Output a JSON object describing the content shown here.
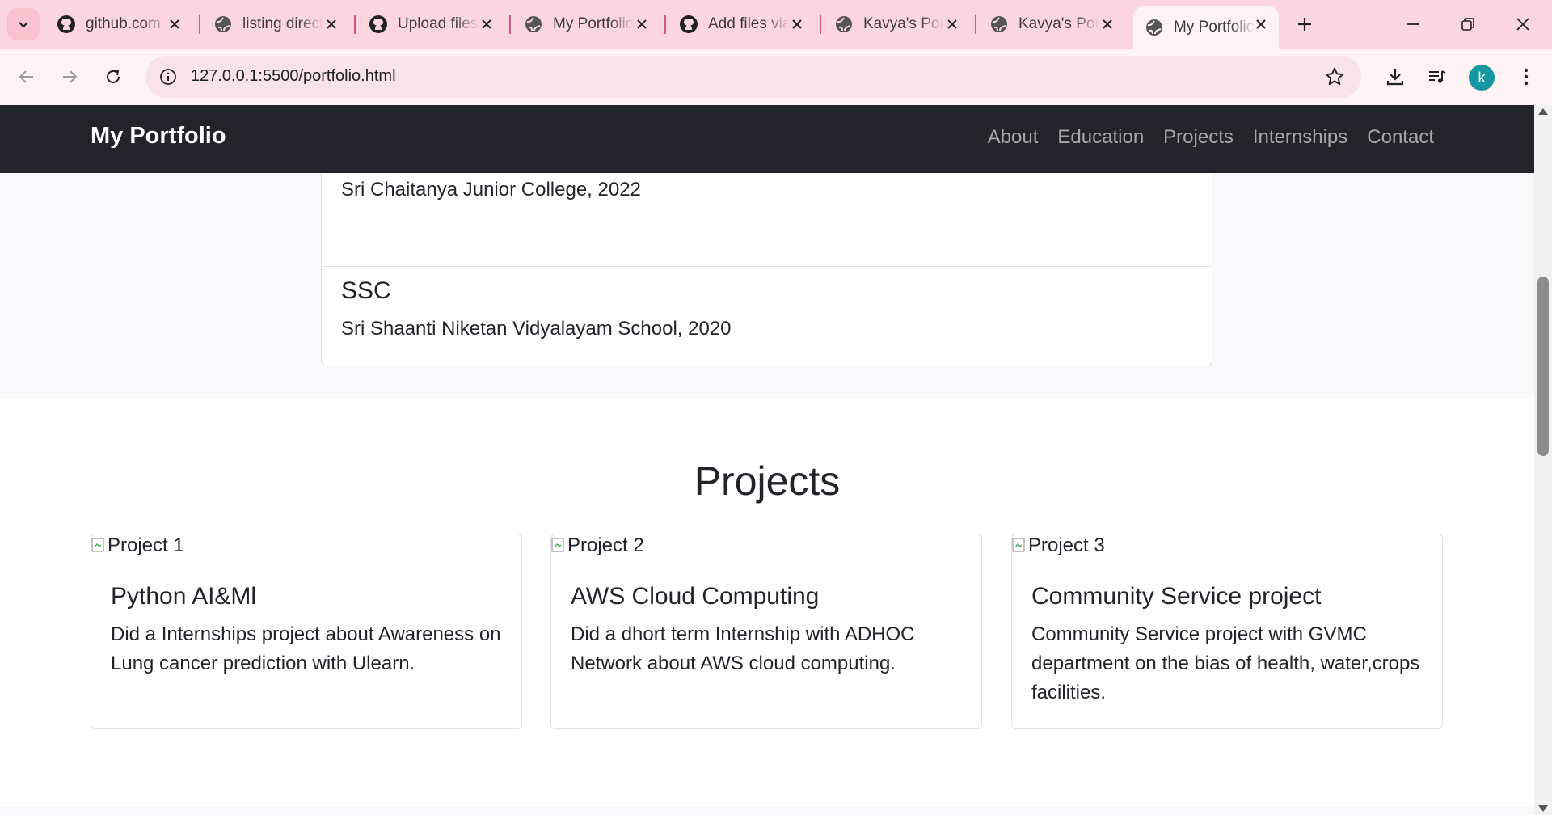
{
  "browser": {
    "tabs": [
      {
        "title": "github.com",
        "icon": "github-icon"
      },
      {
        "title": "listing directory",
        "icon": "globe-icon"
      },
      {
        "title": "Upload files",
        "icon": "github-icon"
      },
      {
        "title": "My Portfolio",
        "icon": "globe-icon"
      },
      {
        "title": "Add files via",
        "icon": "github-icon"
      },
      {
        "title": "Kavya's Portfolio",
        "icon": "globe-icon"
      },
      {
        "title": "Kavya's Portfolio",
        "icon": "globe-icon"
      },
      {
        "title": "My Portfolio",
        "icon": "globe-icon",
        "active": true
      }
    ],
    "url": "127.0.0.1:5500/portfolio.html",
    "profile_initial": "k",
    "colors": {
      "tabbar": "#fcd6de",
      "toolbar": "#fff3f6",
      "avatar": "#1497a1"
    }
  },
  "site": {
    "brand": "My Portfolio",
    "nav": [
      "About",
      "Education",
      "Projects",
      "Internships",
      "Contact"
    ]
  },
  "education": {
    "items": [
      {
        "institution": "Sri Chaitanya Junior College, 2022"
      },
      {
        "title": "SSC",
        "institution": "Sri Shaanti Niketan Vidyalayam School, 2020"
      }
    ]
  },
  "projects": {
    "heading": "Projects",
    "cards": [
      {
        "image_alt": "Project 1",
        "title": "Python AI&Ml",
        "text": "Did a Internships project about Awareness on Lung cancer prediction with Ulearn."
      },
      {
        "image_alt": "Project 2",
        "title": "AWS Cloud Computing",
        "text": "Did a dhort term Internship with ADHOC Network about AWS cloud computing."
      },
      {
        "image_alt": "Project 3",
        "title": "Community Service project",
        "text": "Community Service project with GVMC department on the bias of health, water,crops facilities."
      }
    ]
  }
}
